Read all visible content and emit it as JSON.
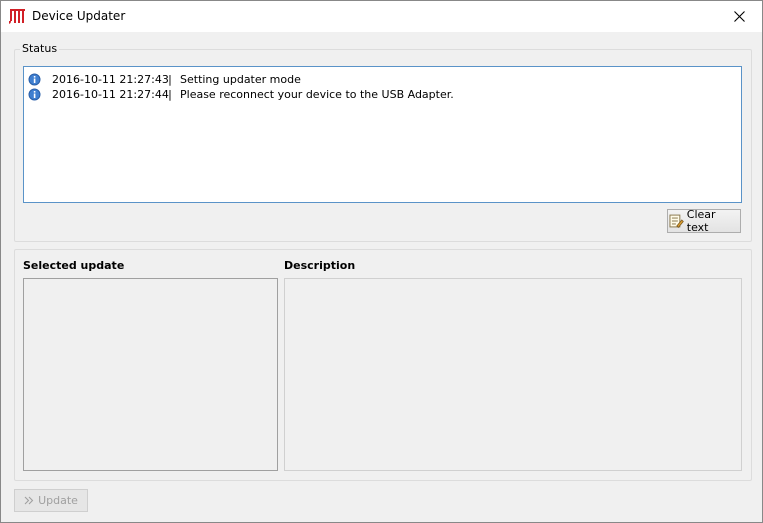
{
  "window": {
    "title": "Device Updater",
    "logo_icon": "jeti-logo-icon",
    "close_icon": "close-icon"
  },
  "status": {
    "label": "Status",
    "log": [
      {
        "icon": "info-icon",
        "timestamp": "2016-10-11 21:27:43",
        "separator": "|",
        "message": "Setting updater mode"
      },
      {
        "icon": "info-icon",
        "timestamp": "2016-10-11 21:27:44",
        "separator": "|",
        "message": "Please reconnect your device to the USB Adapter."
      }
    ],
    "clear_button": {
      "label": "Clear text",
      "icon": "clear-text-icon"
    }
  },
  "update": {
    "selected_label": "Selected update",
    "description_label": "Description",
    "button": {
      "label": "Update",
      "icon": "double-chevron-right-icon",
      "enabled": false
    }
  },
  "colors": {
    "accent": "#5a93c8",
    "logo_red": "#d11f26",
    "window_bg": "#f0f0f0"
  }
}
